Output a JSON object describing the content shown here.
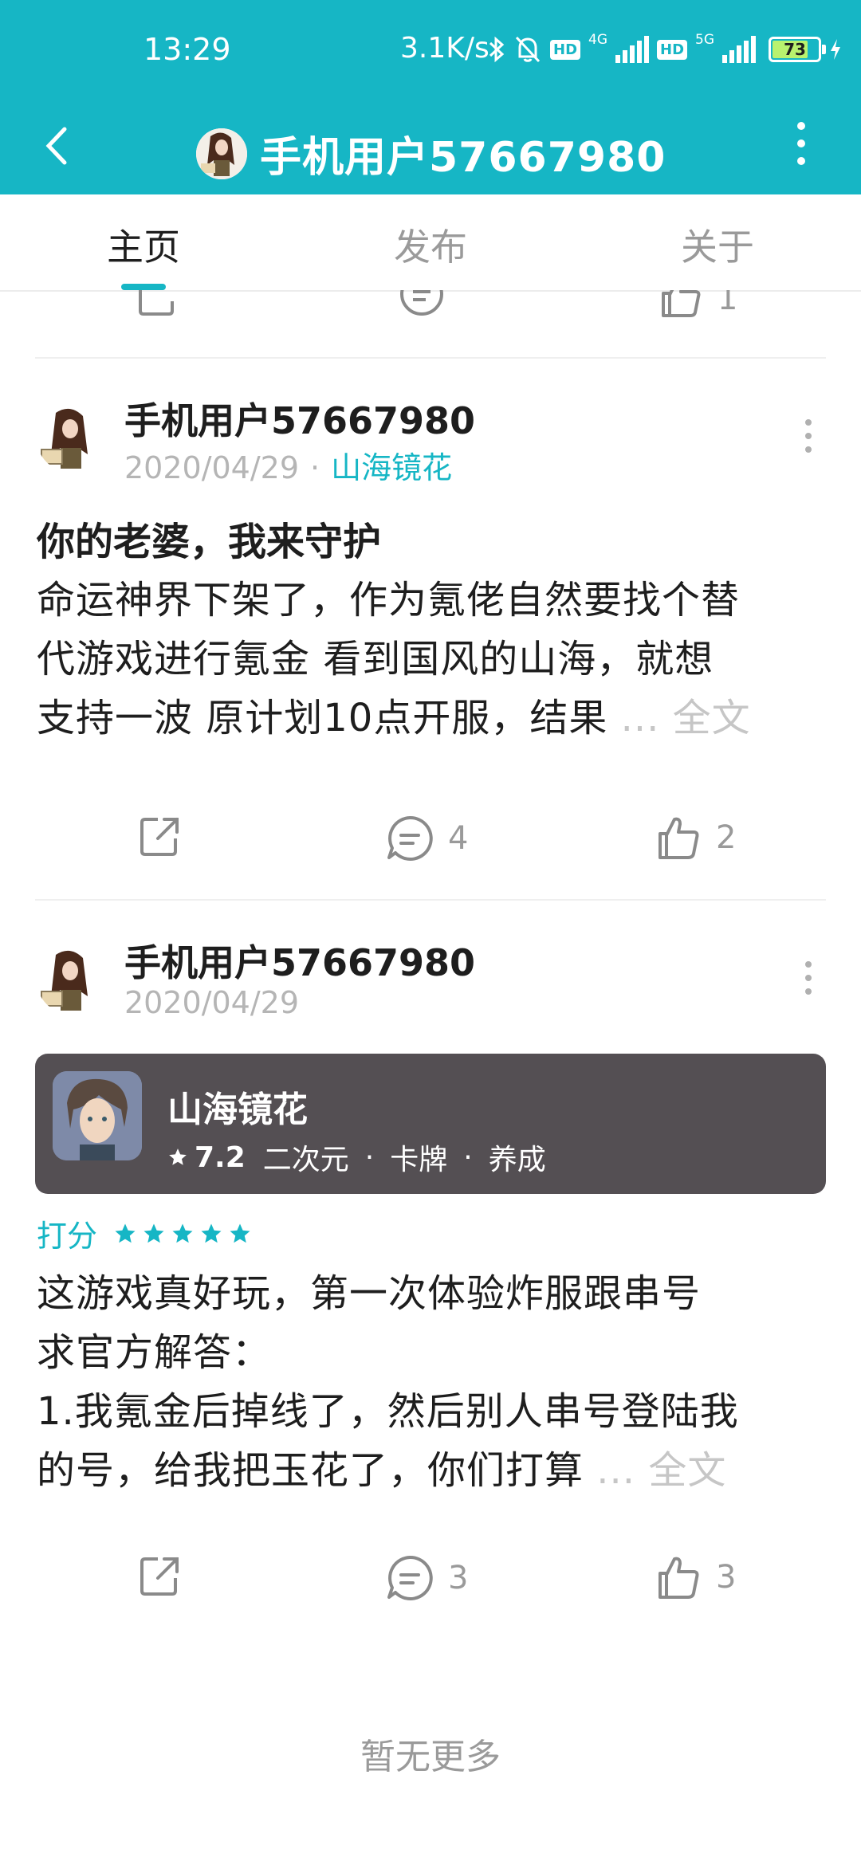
{
  "status_bar": {
    "time": "13:29",
    "speed": "3.1K/s",
    "net1": "4G",
    "net2": "5G",
    "hd1": "HD",
    "hd2": "HD",
    "battery": "73",
    "icons": [
      "bluetooth-icon",
      "bell-off-icon",
      "signal-icon",
      "signal-icon",
      "battery-icon",
      "charging-icon"
    ]
  },
  "header": {
    "title": "手机用户57667980",
    "back_icon": "chevron-left-icon",
    "menu_icon": "more-vertical-icon"
  },
  "tabs": [
    {
      "label": "主页",
      "active": true
    },
    {
      "label": "发布",
      "active": false
    },
    {
      "label": "关于",
      "active": false
    }
  ],
  "prev_post": {
    "likes": "1"
  },
  "posts": [
    {
      "author": "手机用户57667980",
      "date": "2020/04/29",
      "separator": "·",
      "game": "山海镜花",
      "title": "你的老婆，我来守护",
      "lines": [
        "命运神界下架了，作为氪佬自然要找个替",
        "代游戏进行氪金 看到国风的山海，就想",
        "支持一波 原计划10点开服，结果"
      ],
      "more_label": "... 全文",
      "comments": "4",
      "likes": "2"
    },
    {
      "author": "手机用户57667980",
      "date": "2020/04/29",
      "game_card": {
        "name": "山海镜花",
        "score": "7.2",
        "tags": [
          "二次元",
          "卡牌",
          "养成"
        ],
        "tag_separator": "·"
      },
      "rating_label": "打分",
      "rating_stars": 5,
      "lines": [
        "这游戏真好玩，第一次体验炸服跟串号",
        "求官方解答：",
        "1.我氪金后掉线了，然后别人串号登陆我",
        "的号，给我把玉花了，你们打算"
      ],
      "more_label": "... 全文",
      "comments": "3",
      "likes": "3"
    }
  ],
  "footer": {
    "no_more": "暂无更多"
  },
  "colors": {
    "accent": "#16b6c5",
    "card": "#544f53",
    "muted": "#9a9a9a"
  }
}
